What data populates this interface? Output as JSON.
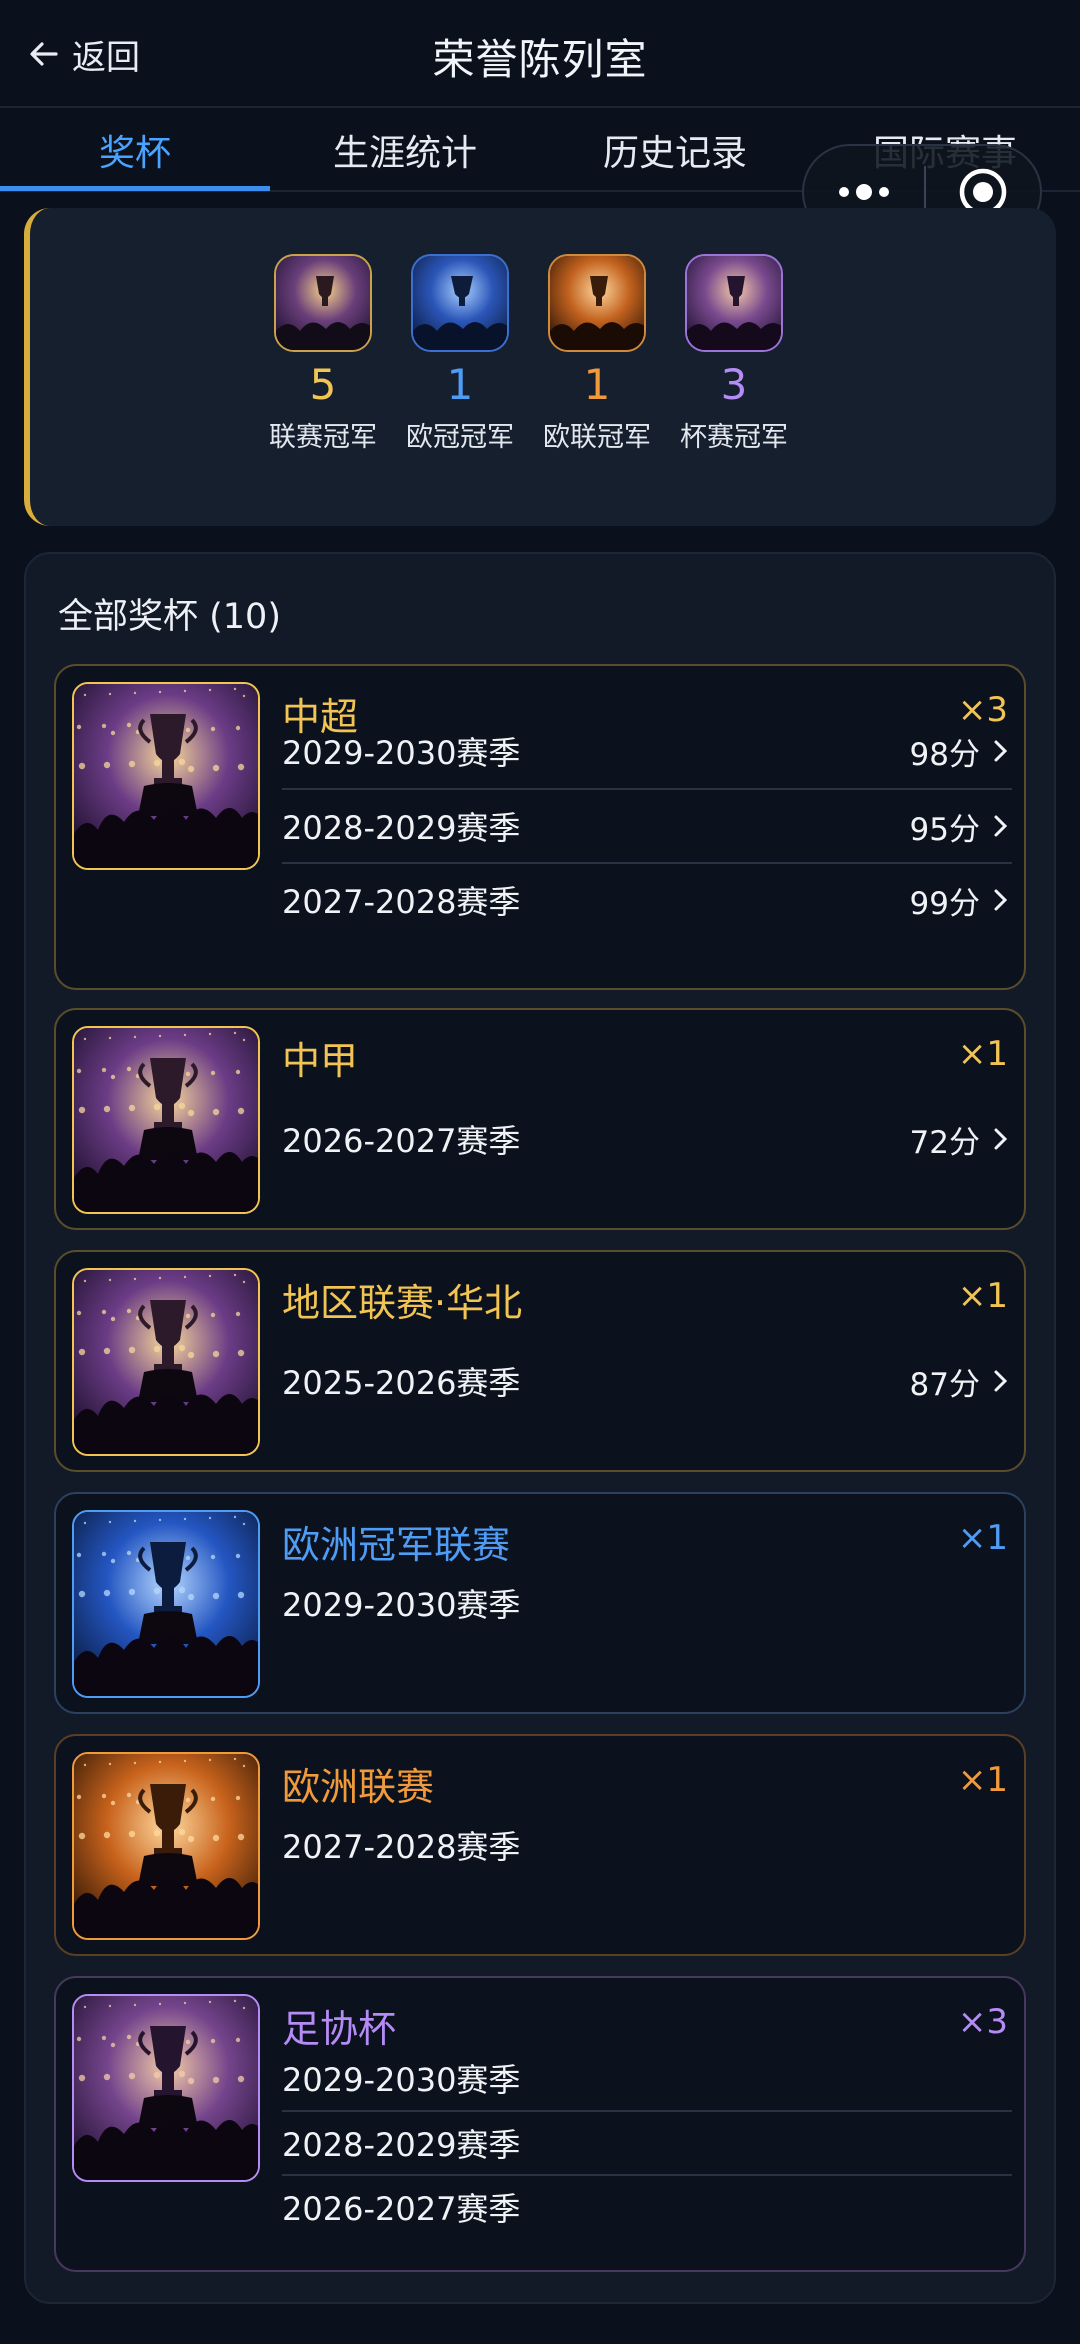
{
  "header": {
    "back_label": "返回",
    "title": "荣誉陈列室"
  },
  "tabs": [
    {
      "label": "奖杯"
    },
    {
      "label": "生涯统计"
    },
    {
      "label": "历史记录"
    },
    {
      "label": "国际赛事"
    }
  ],
  "summary": [
    {
      "count": "5",
      "label": "联赛冠军",
      "color": "#f1c453"
    },
    {
      "count": "1",
      "label": "欧冠冠军",
      "color": "#4f9cf5"
    },
    {
      "count": "1",
      "label": "欧联冠军",
      "color": "#f09a3c"
    },
    {
      "count": "3",
      "label": "杯赛冠军",
      "color": "#b58cf5"
    }
  ],
  "all_trophies": {
    "title": "全部奖杯 (10)",
    "cards": [
      {
        "name": "中超",
        "multiplier": "×3",
        "color": "#f1c453",
        "border": "#5a4d2c",
        "seasons": [
          {
            "label": "2029-2030赛季",
            "score": "98分"
          },
          {
            "label": "2028-2029赛季",
            "score": "95分"
          },
          {
            "label": "2027-2028赛季",
            "score": "99分"
          }
        ]
      },
      {
        "name": "中甲",
        "multiplier": "×1",
        "color": "#f1c453",
        "border": "#5a4d2c",
        "seasons": [
          {
            "label": "2026-2027赛季",
            "score": "72分"
          }
        ]
      },
      {
        "name": "地区联赛·华北",
        "multiplier": "×1",
        "color": "#f1c453",
        "border": "#5a4d2c",
        "seasons": [
          {
            "label": "2025-2026赛季",
            "score": "87分"
          }
        ]
      },
      {
        "name": "欧洲冠军联赛",
        "multiplier": "×1",
        "color": "#4f9cf5",
        "border": "#2c4060",
        "seasons": [
          {
            "label": "2029-2030赛季"
          }
        ]
      },
      {
        "name": "欧洲联赛",
        "multiplier": "×1",
        "color": "#f09a3c",
        "border": "#5a3f24",
        "seasons": [
          {
            "label": "2027-2028赛季"
          }
        ]
      },
      {
        "name": "足协杯",
        "multiplier": "×3",
        "color": "#b58cf5",
        "border": "#47385e",
        "seasons": [
          {
            "label": "2029-2030赛季"
          },
          {
            "label": "2028-2029赛季"
          },
          {
            "label": "2026-2027赛季"
          }
        ]
      }
    ]
  },
  "icons": [
    "back-arrow-icon",
    "more-dots-icon",
    "close-target-icon",
    "chevron-right-icon",
    "trophy-image"
  ]
}
